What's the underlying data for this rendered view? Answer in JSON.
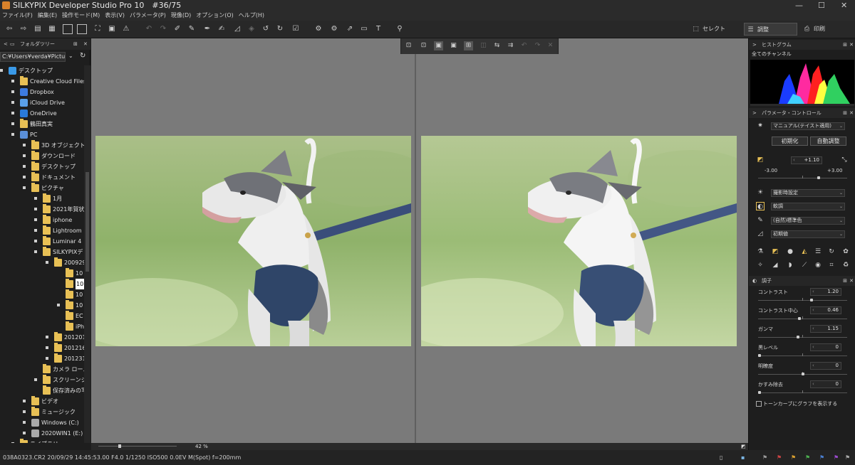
{
  "window": {
    "title": "SILKYPIX Developer Studio Pro 10　#36/75"
  },
  "window_controls": {
    "minimize": "—",
    "maximize": "☐",
    "close": "✕"
  },
  "menu": [
    "ファイル(F)",
    "編集(E)",
    "操作モード(M)",
    "表示(V)",
    "パラメータ(P)",
    "現像(D)",
    "オプション(O)",
    "ヘルプ(H)"
  ],
  "toolbar": {
    "tabs": {
      "select": "セレクト",
      "adjust": "調整",
      "print": "印刷"
    }
  },
  "left_panel": {
    "title": "フォルダツリー",
    "path": "C:¥Users¥verda¥Pictu",
    "tree": [
      {
        "label": "デスクトップ"
      },
      {
        "label": "Creative Cloud Files"
      },
      {
        "label": "Dropbox"
      },
      {
        "label": "iCloud Drive"
      },
      {
        "label": "OneDrive"
      },
      {
        "label": "鶴田真実"
      },
      {
        "label": "PC"
      },
      {
        "label": "3D オブジェクト"
      },
      {
        "label": "ダウンロード"
      },
      {
        "label": "デスクトップ"
      },
      {
        "label": "ドキュメント"
      },
      {
        "label": "ピクチャ"
      },
      {
        "label": "1月"
      },
      {
        "label": "2021年賀状"
      },
      {
        "label": "iphone"
      },
      {
        "label": "Lightroom"
      },
      {
        "label": "Luminar 4"
      },
      {
        "label": "SILKYPIXデ"
      },
      {
        "label": "200929"
      },
      {
        "label": "10"
      },
      {
        "label": "10"
      },
      {
        "label": "10"
      },
      {
        "label": "10"
      },
      {
        "label": "EC"
      },
      {
        "label": "iPh"
      },
      {
        "label": "201201"
      },
      {
        "label": "201216"
      },
      {
        "label": "201231"
      },
      {
        "label": "カメラ ロール"
      },
      {
        "label": "スクリーンショ"
      },
      {
        "label": "保存済みの写"
      },
      {
        "label": "ビデオ"
      },
      {
        "label": "ミュージック"
      },
      {
        "label": "Windows (C:)"
      },
      {
        "label": "2020WIN1 (E:)"
      },
      {
        "label": "ライブラリ"
      }
    ]
  },
  "viewer": {
    "zoom": "42 %"
  },
  "status": {
    "text": "038A0323.CR2 20/09/29 14:45:53.00 F4.0 1/1250 ISO500  0.0EV M(Spot) f=200mm"
  },
  "right_panel": {
    "histogram": {
      "title": "ヒストグラム",
      "channel": "全てのチャンネル"
    },
    "param": {
      "title": "パラメータ・コントロール",
      "taste": "マニュアル(テイスト適用)",
      "init_button": "初期化",
      "auto_button": "自動調整",
      "exposure": {
        "value": "+1.10",
        "min": "-3.00",
        "max": "+3.00",
        "level": 0.683
      },
      "white_balance": "撮影時設定",
      "tone": "軟調",
      "color": "(自然)標準色",
      "sharpness": "初期値"
    },
    "tone": {
      "title": "調子",
      "contrast": {
        "label": "コントラスト",
        "value": "1.20",
        "level": 0.6
      },
      "contrast_center": {
        "label": "コントラスト中心",
        "value": "0.46",
        "level": 0.46
      },
      "gamma": {
        "label": "ガンマ",
        "value": "1.15",
        "level": 0.45
      },
      "black_level": {
        "label": "黒レベル",
        "value": "0",
        "level": 0.0
      },
      "brightness": {
        "label": "明瞭度",
        "value": "0",
        "level": 0.5
      },
      "dehaze": {
        "label": "かすみ除去",
        "value": "0",
        "level": 0.0
      },
      "show_curve": "トーンカーブにグラフを表示する"
    }
  },
  "colors": {
    "accent": "#e8c055",
    "folder": "#e8c055",
    "viewer_bg": "#7a7a7a",
    "panel_bg": "#1e1e1e"
  }
}
